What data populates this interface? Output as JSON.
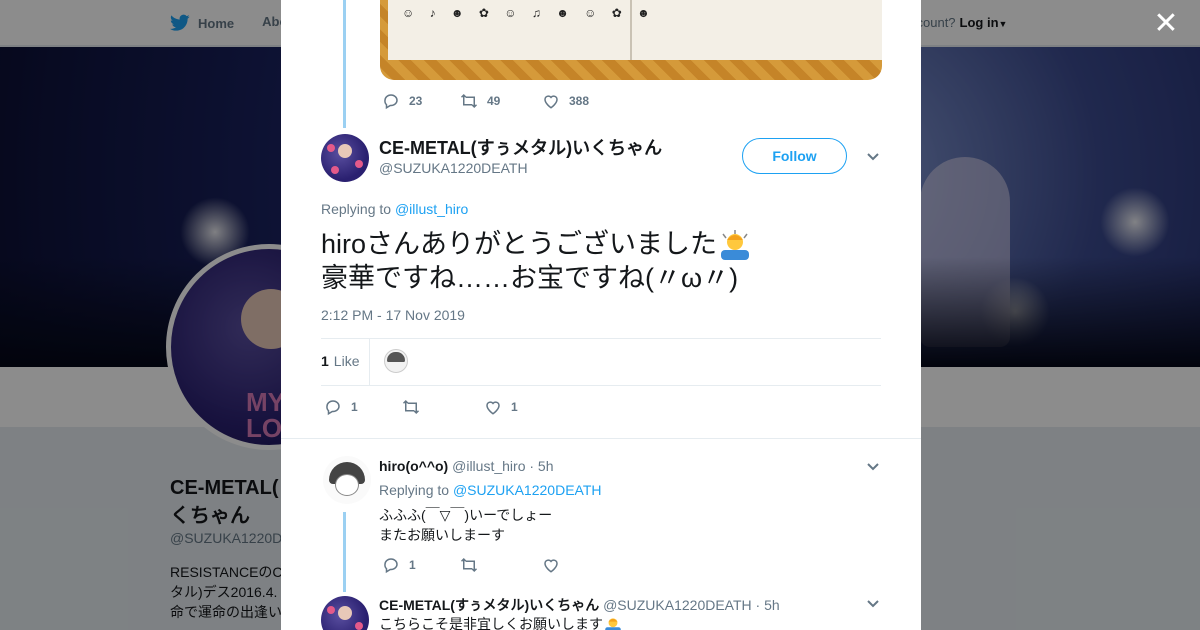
{
  "topbar": {
    "home_label": "Home",
    "about_label": "Abo",
    "account_prompt": "ccount?",
    "login_label": "Log in"
  },
  "profile": {
    "name_line1": "CE-METAL(",
    "name_line2": "くちゃん",
    "handle": "@SUZUKA1220D",
    "bio_line1": "RESISTANCEのC",
    "bio_line2": "タル)デス2016.4.",
    "bio_line3": "命で運命の出逢い"
  },
  "modal": {
    "parent_tweet": {
      "reply_count": "23",
      "retweet_count": "49",
      "like_count": "388"
    },
    "main_tweet": {
      "display_name": "CE-METAL(すぅメタル)いくちゃん",
      "screen_name": "@SUZUKA1220DEATH",
      "follow_label": "Follow",
      "replying_label": "Replying to",
      "replying_handle": "@illust_hiro",
      "text_line1": "hiroさんありがとうございました",
      "text_line2": "豪華ですね……お宝ですね(〃ω〃)",
      "timestamp": "2:12 PM - 17 Nov 2019",
      "likes_count": "1",
      "likes_label": "Like",
      "reply_count": "1",
      "retweet_count": "",
      "like_count": "1"
    },
    "reply_1": {
      "display_name": "hiro(o^^o)",
      "screen_name": "@illust_hiro",
      "time": "· 5h",
      "replying_label": "Replying to",
      "replying_handle": "@SUZUKA1220DEATH",
      "text_line1": "ふふふ(￣▽￣)いーでしょー",
      "text_line2": "またお願いしまーす",
      "reply_count": "1"
    },
    "reply_2": {
      "display_name": "CE-METAL(すぅメタル)いくちゃん",
      "screen_name": "@SUZUKA1220DEATH",
      "time": "· 5h",
      "text_line1": "こちらこそ是非宜しくお願いします"
    }
  },
  "colors": {
    "accent": "#1da1f2",
    "muted_text": "#657786",
    "body_text": "#14171a",
    "thread_line": "#9bd0f2"
  },
  "icons": [
    "twitter-bird-icon",
    "close-icon",
    "reply-icon",
    "retweet-icon",
    "heart-icon",
    "chevron-down-icon",
    "bowing-person-emoji"
  ]
}
